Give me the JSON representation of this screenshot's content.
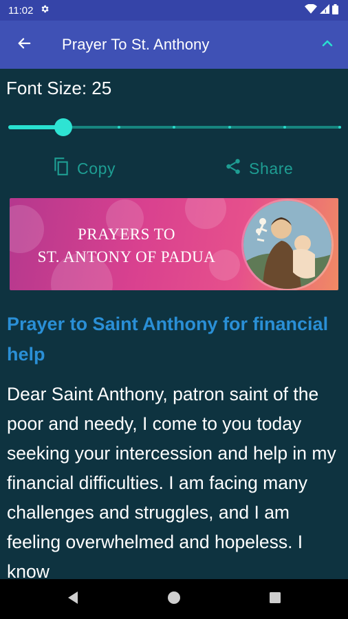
{
  "status_bar": {
    "time": "11:02",
    "icons": [
      "gear-icon",
      "wifi-icon",
      "cellular-signal-icon",
      "battery-icon"
    ]
  },
  "app_bar": {
    "title": "Prayer To St. Anthony",
    "back_icon": "arrow-back-icon",
    "collapse_icon": "chevron-up-icon",
    "color": "#3f51b5"
  },
  "font_size": {
    "label": "Font Size: 25",
    "slider_fraction": 0.166
  },
  "actions": {
    "copy_label": "Copy",
    "share_label": "Share"
  },
  "banner": {
    "line1": "PRAYERS TO",
    "line2": "ST. ANTONY OF PADUA"
  },
  "prayer": {
    "title": "Prayer to Saint Anthony for financial help",
    "body": "Dear Saint Anthony, patron saint of the poor and needy, I come to you today seeking your intercession and help in my financial difficulties. I am facing many challenges and struggles, and I am feeling overwhelmed and hopeless. I know"
  },
  "colors": {
    "background": "#0e3340",
    "accent": "#29e0d0",
    "title": "#2a8fd6"
  }
}
